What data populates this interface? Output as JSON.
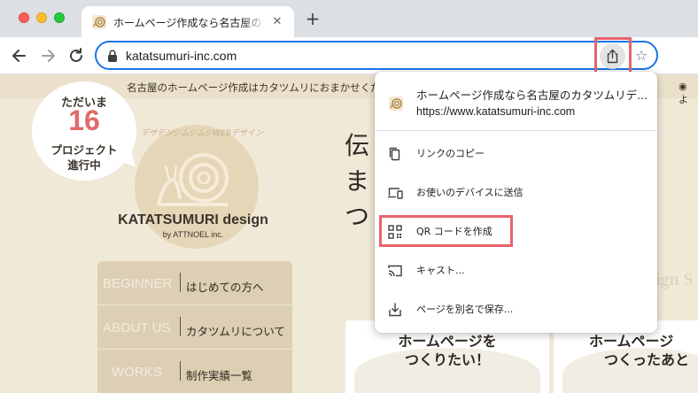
{
  "browser": {
    "tab": {
      "title": "ホームページ作成なら名古屋のカタツムリ",
      "close_glyph": "✕",
      "favicon": "snail-icon"
    },
    "new_tab_glyph": "+",
    "nav": {
      "back_icon": "arrow-left-icon",
      "forward_icon": "arrow-right-icon",
      "reload_icon": "reload-icon"
    },
    "omnibox": {
      "url": "katatsumuri-inc.com",
      "lock_icon": "lock-icon"
    },
    "share_icon": "share-icon",
    "star_glyph": "☆"
  },
  "share_menu": {
    "page_title": "ホームページ作成なら名古屋のカタツムリデ...",
    "page_url": "https://www.katatsumuri-inc.com",
    "items": [
      {
        "label": "リンクのコピー",
        "icon": "copy-icon"
      },
      {
        "label": "お使いのデバイスに送信",
        "icon": "devices-icon"
      },
      {
        "label": "QR コードを作成",
        "icon": "qr-code-icon"
      },
      {
        "label": "キャスト...",
        "icon": "cast-icon"
      },
      {
        "label": "ページを別名で保存...",
        "icon": "save-icon"
      }
    ]
  },
  "site": {
    "tagline": "名古屋のホームページ作成はカタツムリにおまかせくださ",
    "top_right": "◉ よ",
    "bubble": {
      "line1": "ただいま",
      "number": "16",
      "line2": "プロジェクト",
      "line3": "進行中"
    },
    "logo": {
      "arc_text": "デザデンシムシムシWEBデザイン",
      "name": "KATATSUMURI design",
      "sub": "by ATTNOEL inc."
    },
    "nav": [
      {
        "en": "BEGINNER",
        "ja": "はじめての方へ"
      },
      {
        "en": "ABOUT US",
        "ja": "カタツムリについて"
      },
      {
        "en": "WORKS",
        "ja": "制作実績一覧"
      }
    ],
    "hero_lines": [
      "伝",
      "ま",
      "つ"
    ],
    "ghost_text": "ign S",
    "cards": [
      {
        "line1": "ホームページを",
        "line2": "つくりたい！"
      },
      {
        "line1": "ホームページ",
        "line2": "つくったあと"
      }
    ]
  },
  "colors": {
    "accent": "#1a73e8",
    "highlight": "#e8646c",
    "site_bg": "#f1e9d8",
    "bubble_number": "#e06a6a"
  }
}
